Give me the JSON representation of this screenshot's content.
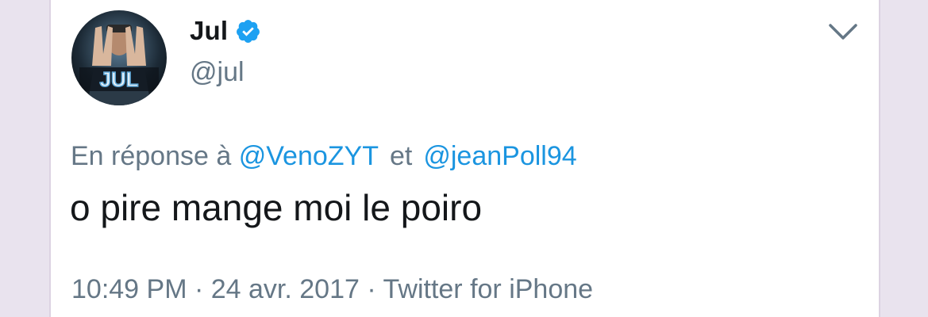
{
  "tweet": {
    "author": {
      "name": "Jul",
      "handle": "@jul",
      "verified": true,
      "avatar_text": "JUL"
    },
    "reply": {
      "prefix": "En réponse à",
      "mention1": "@VenoZYT",
      "conjunction": "et",
      "mention2": "@jeanPoll94"
    },
    "text": "o pire mange moi le poiro",
    "meta": "10:49 PM · 24 avr. 2017 · Twitter for iPhone",
    "menu_icon": "chevron-down-icon"
  },
  "colors": {
    "link": "#1b95e0",
    "secondary": "#657786",
    "primary_text": "#14171a",
    "verified": "#1da1f2"
  }
}
